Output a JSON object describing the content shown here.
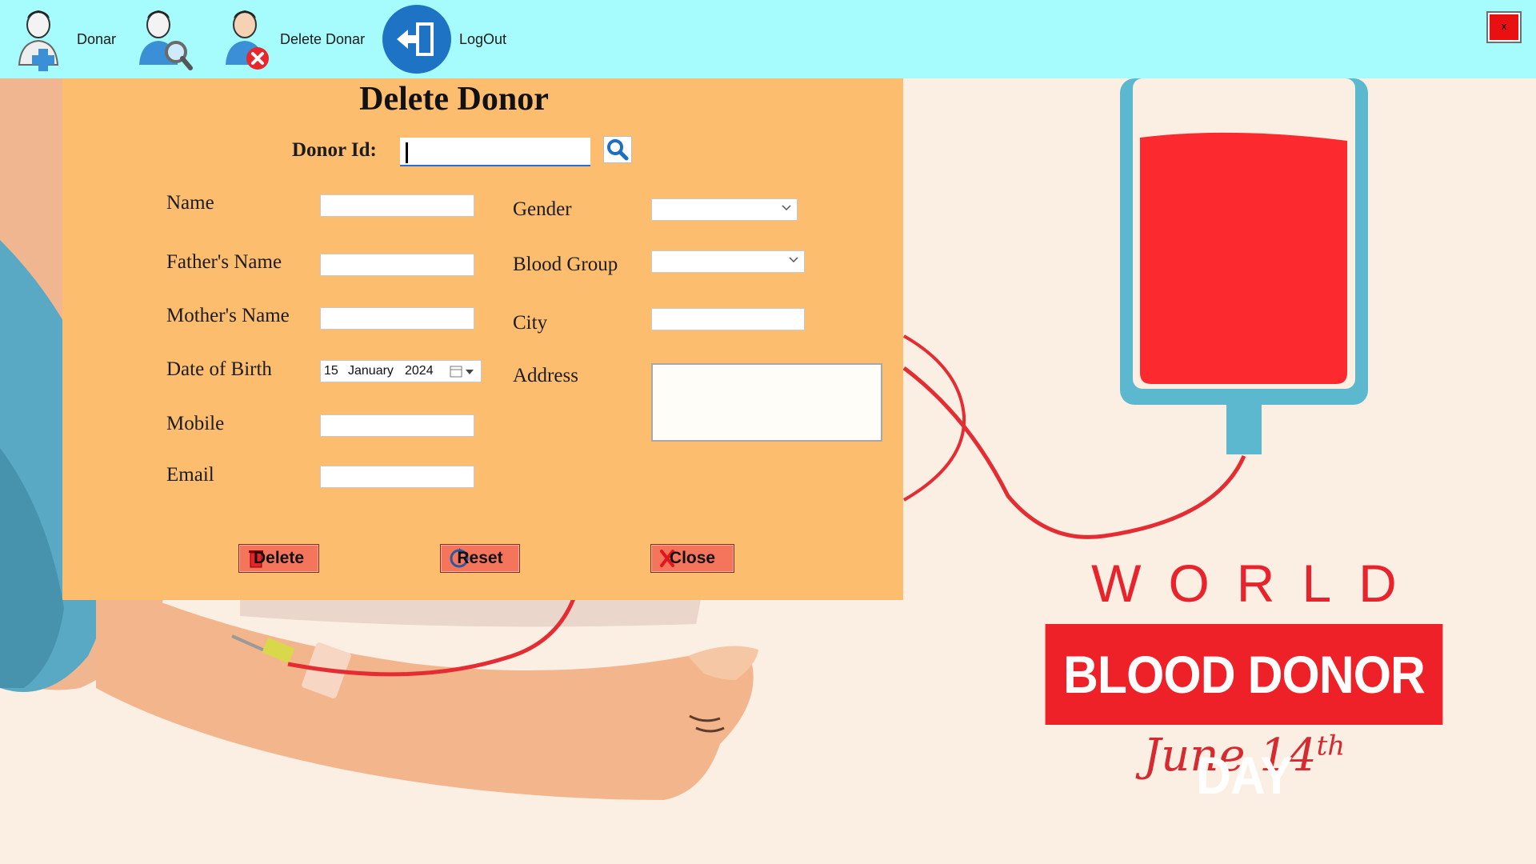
{
  "toolbar": {
    "items": [
      {
        "label": "Donar",
        "icon": "add-donor-icon"
      },
      {
        "label": "",
        "icon": "search-donor-icon"
      },
      {
        "label": "Delete Donar",
        "icon": "delete-donor-icon"
      },
      {
        "label": "LogOut",
        "icon": "logout-icon"
      }
    ],
    "close_label": "x",
    "background": "#a6fbfc"
  },
  "dialog": {
    "title": "Delete Donor",
    "donor_id": {
      "label": "Donor Id:",
      "value": ""
    },
    "left_fields": {
      "name": {
        "label": "Name",
        "value": ""
      },
      "fathers_name": {
        "label": "Father's Name",
        "value": ""
      },
      "mothers_name": {
        "label": "Mother's Name",
        "value": ""
      },
      "date_of_birth": {
        "label": "Date of Birth",
        "day": "15",
        "month": "January",
        "year": "2024"
      },
      "mobile": {
        "label": "Mobile",
        "value": ""
      },
      "email": {
        "label": "Email",
        "value": ""
      }
    },
    "right_fields": {
      "gender": {
        "label": "Gender",
        "value": ""
      },
      "blood_group": {
        "label": "Blood Group",
        "value": ""
      },
      "city": {
        "label": "City",
        "value": ""
      },
      "address": {
        "label": "Address",
        "value": ""
      }
    },
    "buttons": {
      "delete": "Delete",
      "reset": "Reset",
      "close": "Close"
    },
    "background": "#fdbd6f",
    "button_color": "#f4745c"
  },
  "promo": {
    "world": "WORLD",
    "banner": "BLOOD DONOR DAY",
    "date": "June 14",
    "date_suffix": "th"
  }
}
